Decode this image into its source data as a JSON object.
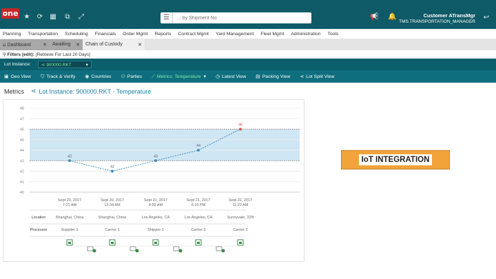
{
  "app": {
    "logo_text": "one",
    "search_placeholder": "... by Shipment No",
    "user_name": "Customer ATransMgr",
    "user_role": "TMS.TRANSPORTATION_MANAGER",
    "icons": [
      "star-icon",
      "refresh-icon",
      "grid-icon",
      "window-icon",
      "expand-icon",
      "menu-icon",
      "megaphone-icon",
      "bell-icon",
      "back-arrow-icon"
    ]
  },
  "nav": {
    "items": [
      "Planning",
      "Transportation",
      "Scheduling",
      "Financials",
      "Order Mgmt",
      "Reports",
      "Contract Mgmt",
      "Yard Management",
      "Fleet Mgmt",
      "Administration",
      "Tools"
    ]
  },
  "tabs": [
    {
      "label": "Dashboard",
      "icon": "home-icon"
    },
    {
      "label": "Awaiting"
    },
    {
      "label": "Chain of Custody"
    }
  ],
  "filters": {
    "label": "Filters (edit):",
    "value": "[Retrieve For Last 20 Days]"
  },
  "instance": {
    "label": "Lot Instance:",
    "value": "900000.RKT"
  },
  "toolbar": [
    {
      "label": "Geo View",
      "icon": "map-icon"
    },
    {
      "label": "Track & Verify",
      "icon": "shield-icon"
    },
    {
      "label": "Countries",
      "icon": "globe-icon"
    },
    {
      "label": "Parties",
      "icon": "people-icon"
    },
    {
      "label": "Metrics: Temperature",
      "icon": "chart-icon",
      "active": true
    },
    {
      "label": "Latest View",
      "icon": "clock-icon"
    },
    {
      "label": "Packing View",
      "icon": "box-icon"
    },
    {
      "label": "Lot Split View",
      "icon": "split-icon"
    }
  ],
  "metrics": {
    "label": "Metrics",
    "title": "Lot Instance: 900000.RKT  -  Temperature"
  },
  "chart_data": {
    "type": "line",
    "title": "",
    "xlabel": "",
    "ylabel": "",
    "ylim": [
      40,
      48
    ],
    "yticks": [
      40,
      41,
      42,
      43,
      44,
      45,
      46,
      47,
      48
    ],
    "band": [
      43,
      46
    ],
    "x": [
      "Sept 20, 2017 7:21 AM",
      "Sept 20, 2017 12:34 AM",
      "Sept 21, 2017 8:59 AM",
      "Sept 21, 2017 6:15 PM",
      "Sept 22, 2017 11:22 AM"
    ],
    "x_lines": [
      [
        "Sept 20, 2017",
        "7:21 AM"
      ],
      [
        "Sept 20, 2017",
        "12:34 AM"
      ],
      [
        "Sept 21, 2017",
        "8:59 AM"
      ],
      [
        "Sept 21, 2017",
        "6:15 PM"
      ],
      [
        "Sept 22, 2017",
        "11:22 AM"
      ]
    ],
    "series": [
      {
        "values": [
          43,
          42,
          43,
          44,
          46
        ]
      }
    ],
    "point_labels": [
      "43",
      "42",
      "43",
      "44",
      "46"
    ],
    "alert_index": 4,
    "colors": {
      "line": "#3a8fc0",
      "band": "#cfe6f4",
      "alert": "#d9534f",
      "grid": "#ececec",
      "threshold": "#666666"
    },
    "grid": true,
    "legend": "none"
  },
  "info_table": {
    "row_labels": [
      "Location",
      "Processor"
    ],
    "locations": [
      "Shanghai, China",
      "Shanghai, China",
      "Los Angeles, CA",
      "Los Angeles, CA",
      "Sunnyvale, 22N"
    ],
    "processors": [
      "Supplier 1",
      "Carrier 1",
      "Shipper 1",
      "Carrier 2",
      "Carrier 2"
    ],
    "flow_icons": [
      "box-icon",
      "truck-icon",
      "box-icon",
      "truck-icon",
      "box-icon",
      "truck-icon",
      "box-icon",
      "truck-icon",
      "box-icon"
    ]
  },
  "badge": {
    "text": "IoT INTEGRATION"
  }
}
